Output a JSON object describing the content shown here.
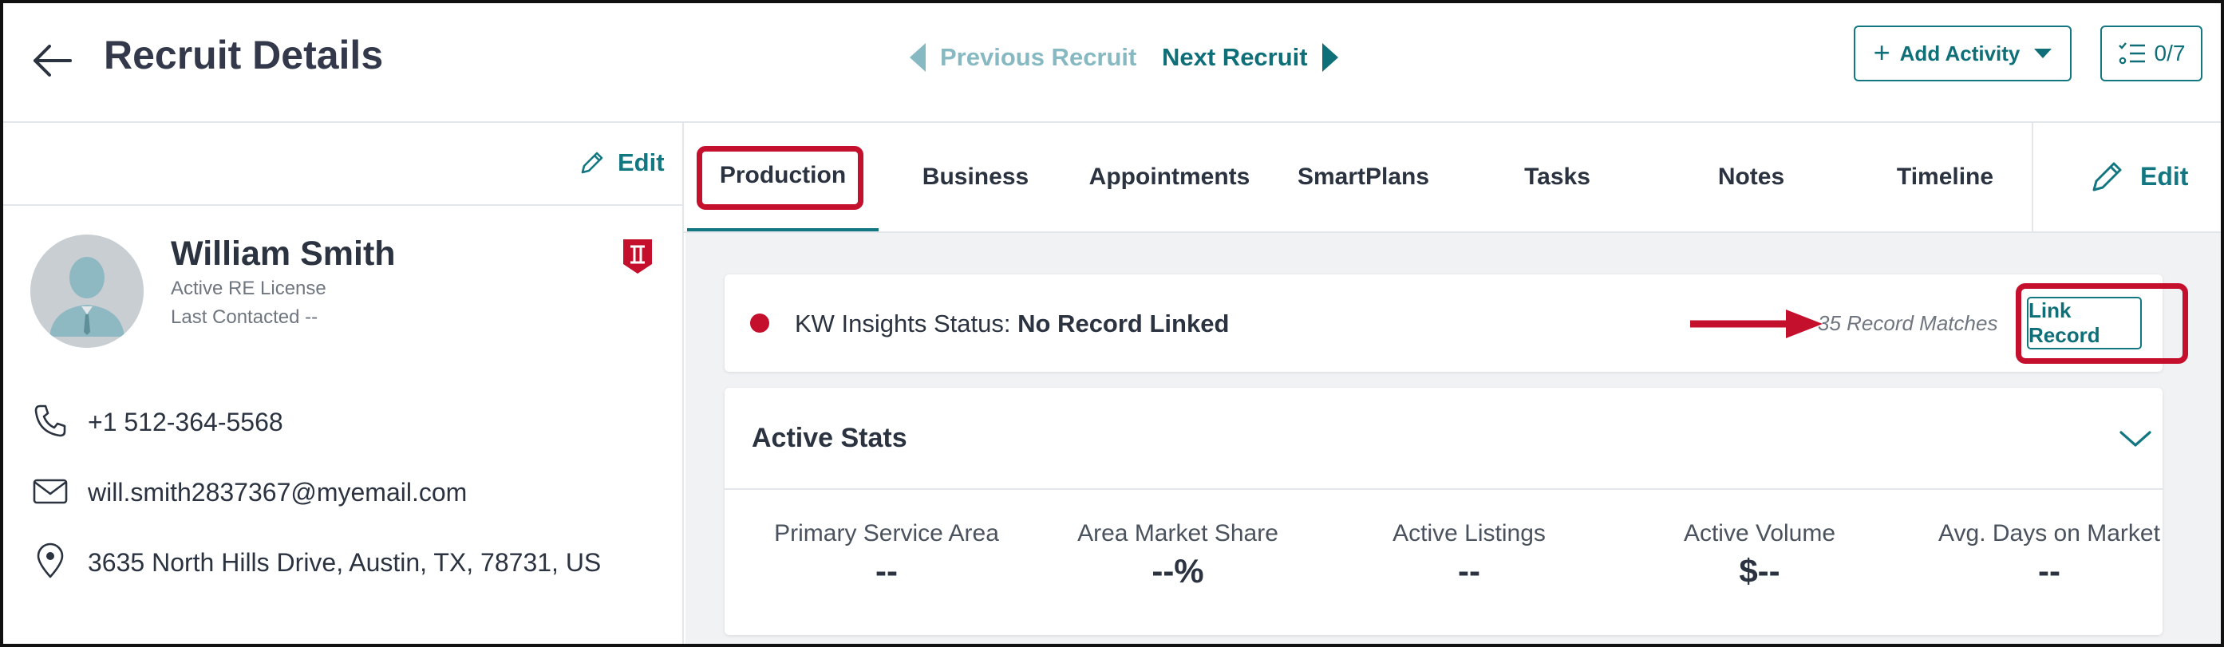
{
  "header": {
    "title": "Recruit Details",
    "prev_label": "Previous Recruit",
    "next_label": "Next Recruit",
    "add_activity_label": "Add Activity",
    "checklist_count": "0/7"
  },
  "contact": {
    "edit_label": "Edit",
    "name": "William Smith",
    "license": "Active RE License",
    "last_contacted": "Last Contacted --",
    "phone": "+1 512-364-5568",
    "email": "will.smith2837367@myemail.com",
    "address": "3635 North Hills Drive, Austin, TX, 78731, US"
  },
  "tabs": [
    {
      "label": "Production",
      "active": true
    },
    {
      "label": "Business"
    },
    {
      "label": "Appointments"
    },
    {
      "label": "SmartPlans"
    },
    {
      "label": "Tasks"
    },
    {
      "label": "Notes"
    },
    {
      "label": "Timeline"
    }
  ],
  "tabs_edit_label": "Edit",
  "insights": {
    "status_label": "KW Insights Status:",
    "status_value": "No Record Linked",
    "matches": "35 Record Matches",
    "link_label": "Link Record"
  },
  "stats": {
    "title": "Active Stats",
    "items": [
      {
        "label": "Primary Service Area",
        "value": "--"
      },
      {
        "label": "Area Market Share",
        "value": "--%"
      },
      {
        "label": "Active Listings",
        "value": "--"
      },
      {
        "label": "Active Volume",
        "value": "$--"
      },
      {
        "label": "Avg. Days on Market",
        "value": "--"
      }
    ]
  },
  "colors": {
    "accent": "#137782",
    "highlight_red": "#c4102c",
    "disabled_teal": "#86b9c1"
  }
}
